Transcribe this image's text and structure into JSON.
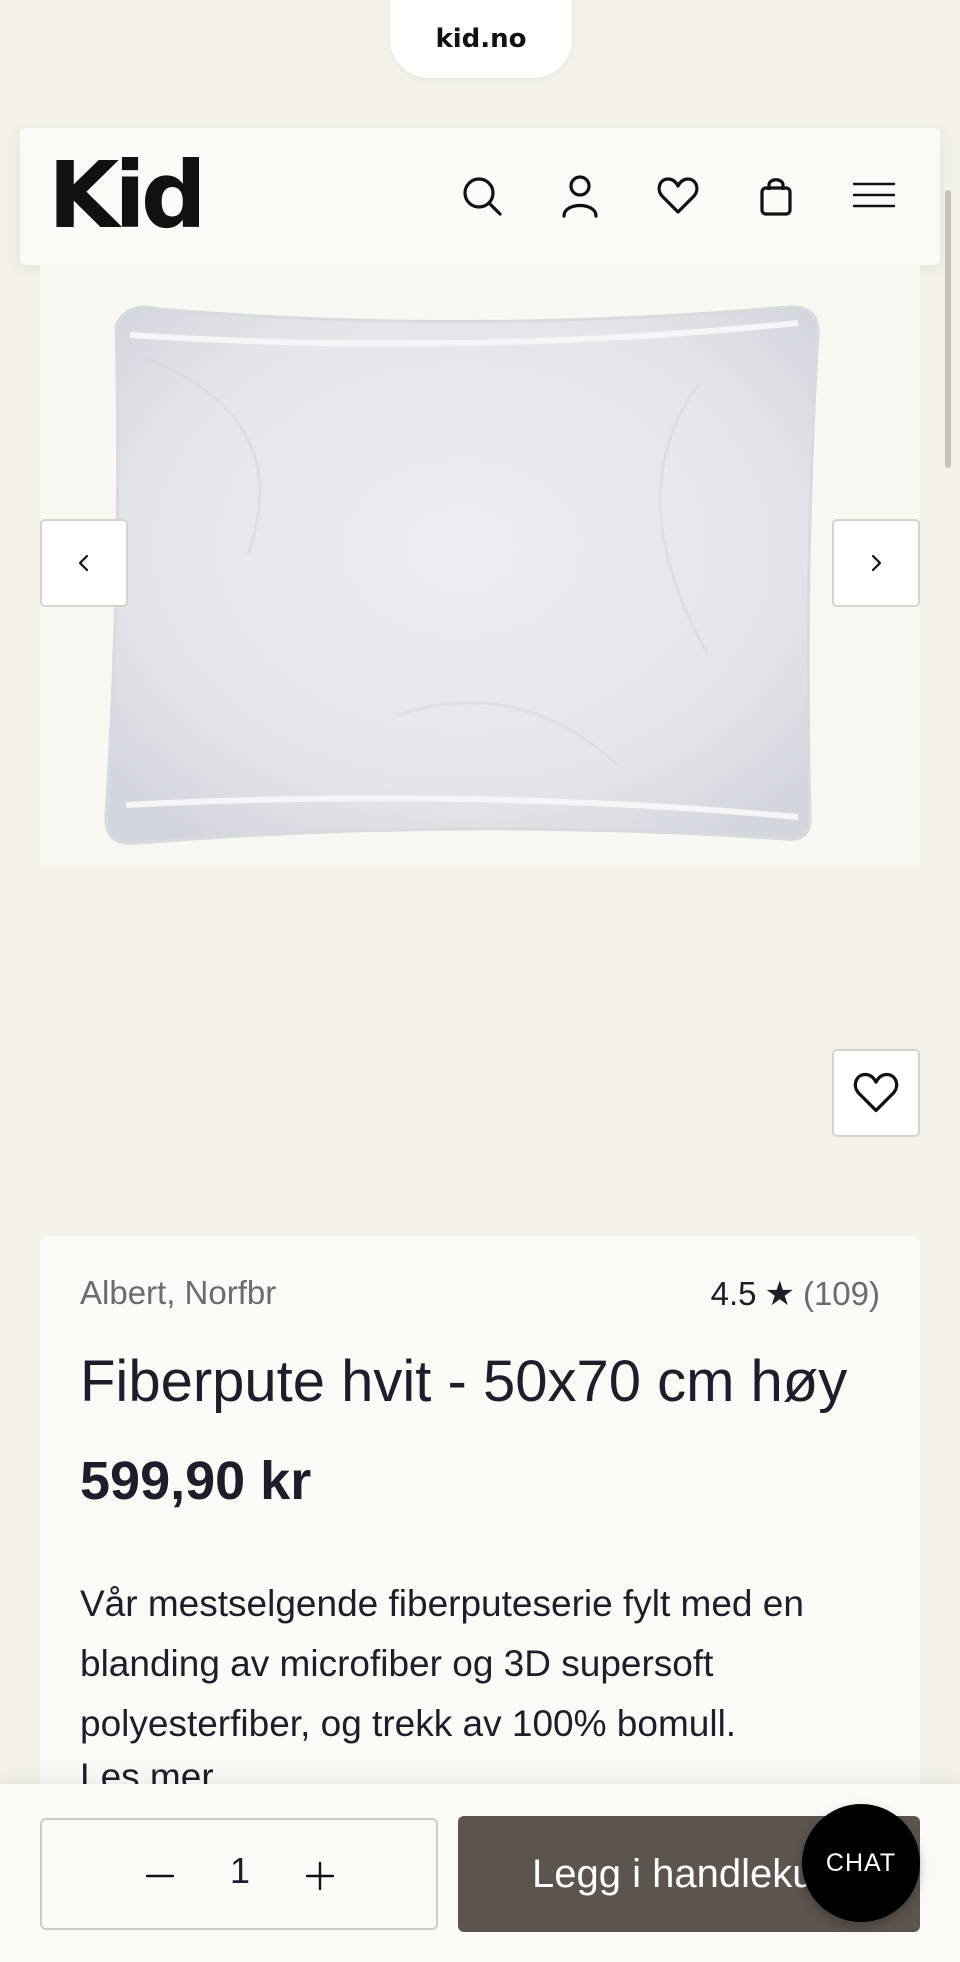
{
  "browser": {
    "url": "kid.no"
  },
  "header": {
    "logo": "Kid",
    "icons": [
      "search-icon",
      "account-icon",
      "heart-icon",
      "bag-icon",
      "menu-icon"
    ]
  },
  "gallery": {
    "image": "white pillow",
    "prev_icon": "chevron-left-icon",
    "next_icon": "chevron-right-icon",
    "favorite_icon": "heart-icon"
  },
  "product": {
    "brand": "Albert, Norfbr",
    "rating": "4.5",
    "rating_icon": "★",
    "review_count": "(109)",
    "title": "Fiberpute hvit - 50x70 cm høy",
    "price": "599,90 kr",
    "description": "Vår mestselgende fiberputeserie fylt med en blanding av microfiber og 3D supersoft polyesterfiber, og trekk av 100% bomull.",
    "read_more": "Les mer"
  },
  "purchase": {
    "quantity": "1",
    "minus_icon": "minus-icon",
    "plus_icon": "plus-icon",
    "add_to_cart": "Legg i handlekurv"
  },
  "chat": {
    "label": "CHAT"
  },
  "colors": {
    "background": "#f4f1eb",
    "card": "#fbfaf6",
    "primary_button": "#5b544f",
    "text": "#1f1d2b",
    "muted": "#6d6b6b"
  }
}
